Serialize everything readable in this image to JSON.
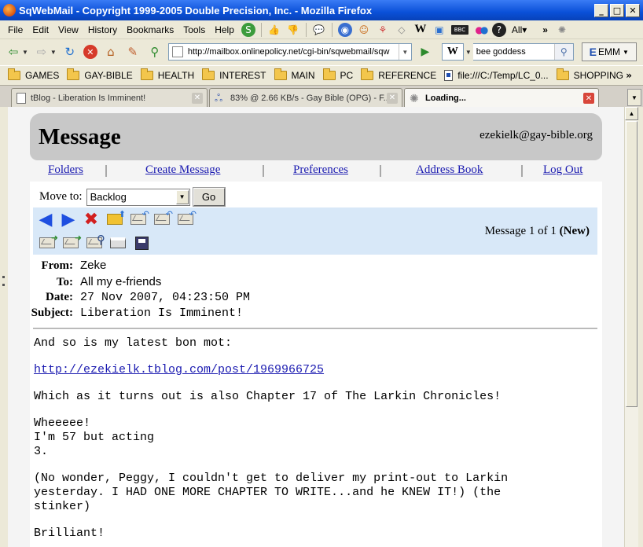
{
  "window": {
    "title": "SqWebMail - Copyright 1999-2005 Double Precision, Inc. - Mozilla Firefox",
    "buttons": [
      "_",
      "□",
      "✕"
    ]
  },
  "menubar": {
    "items": [
      "File",
      "Edit",
      "View",
      "History",
      "Bookmarks",
      "Tools",
      "Help"
    ],
    "all_label": "All▾",
    "overflow": "»"
  },
  "navbar": {
    "url": "http://mailbox.onlinepolicy.net/cgi-bin/sqwebmail/sqw",
    "search_engine": "W",
    "search_value": "bee goddess",
    "emm_label": "EMM"
  },
  "bookmarks": {
    "items": [
      {
        "label": "GAMES",
        "type": "folder"
      },
      {
        "label": "GAY-BIBLE",
        "type": "folder"
      },
      {
        "label": "HEALTH",
        "type": "folder"
      },
      {
        "label": "INTEREST",
        "type": "folder"
      },
      {
        "label": "MAIN",
        "type": "folder"
      },
      {
        "label": "PC",
        "type": "folder"
      },
      {
        "label": "REFERENCE",
        "type": "folder"
      },
      {
        "label": "file:///C:/Temp/LC_0...",
        "type": "file"
      },
      {
        "label": "SHOPPING",
        "type": "folder"
      }
    ],
    "overflow": "»"
  },
  "tabs": [
    {
      "label": "tBlog - Liberation Is Imminent!",
      "active": false
    },
    {
      "label": "83% @ 2.66 KB/s - Gay Bible (OPG) - F...",
      "active": false
    },
    {
      "label": "Loading...",
      "active": true
    }
  ],
  "webmail": {
    "page_title": "Message",
    "user_email": "ezekielk@gay-bible.org",
    "nav": [
      "Folders",
      "Create Message",
      "Preferences",
      "Address Book",
      "Log Out"
    ],
    "move_to_label": "Move to:",
    "move_to_value": "Backlog",
    "go_label": "Go",
    "msg_count_prefix": "Message 1 of 1",
    "msg_count_status": "(New)",
    "headers": {
      "from_label": "From:",
      "from": "Zeke",
      "to_label": "To:",
      "to": "All my e-friends",
      "date_label": "Date:",
      "date": "27 Nov 2007, 04:23:50 PM",
      "subject_label": "Subject:",
      "subject": "Liberation Is Imminent!"
    },
    "body": {
      "line1": "And so is my latest bon mot:",
      "link": "http://ezekielk.tblog.com/post/1969966725",
      "line2": "Which as it turns out is also Chapter 17 of The Larkin Chronicles!",
      "line3": "Wheeeee!\nI'm 57 but acting\n3.",
      "line4": "(No wonder, Peggy, I couldn't get to deliver my print-out to Larkin\nyesterday. I HAD ONE MORE CHAPTER TO WRITE...and he KNEW IT!) (the\nstinker)",
      "line5": "Brilliant!"
    }
  },
  "colors": {
    "titlebar": "#0a50d8",
    "header_bg": "#c8c8c8",
    "toolbox_bg": "#d8e8f8",
    "link": "#1a1ab0"
  }
}
